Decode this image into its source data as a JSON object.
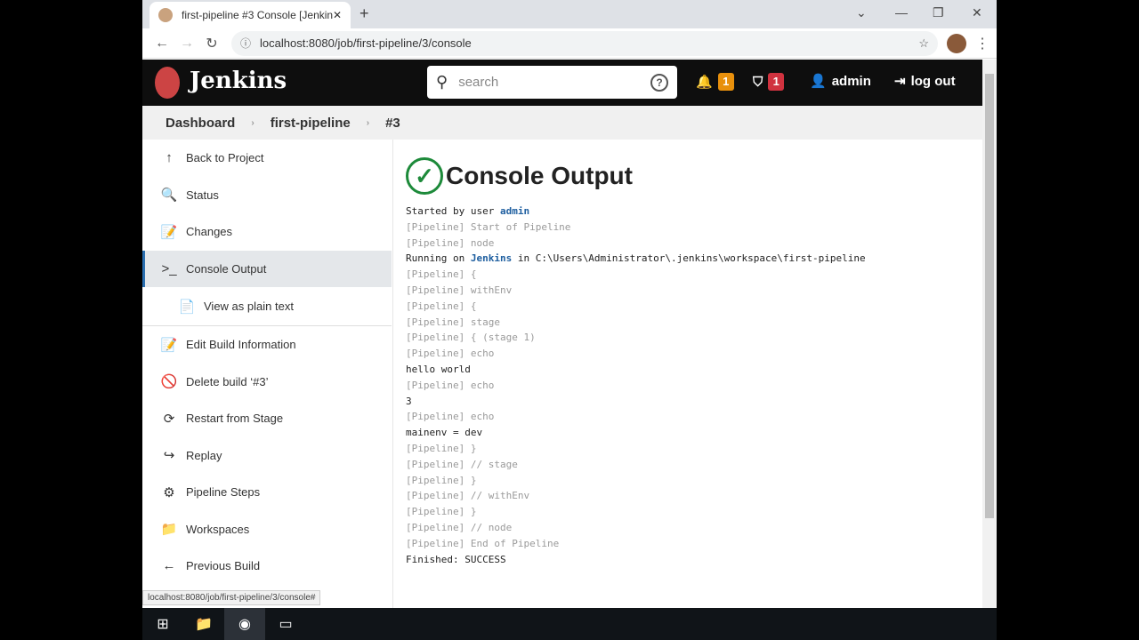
{
  "browser": {
    "tab_title": "first-pipeline #3 Console [Jenkins]",
    "url": "localhost:8080/job/first-pipeline/3/console",
    "status_url": "localhost:8080/job/first-pipeline/3/console#"
  },
  "header": {
    "brand": "Jenkins",
    "search_placeholder": "search",
    "notifications": "1",
    "security": "1",
    "user": "admin",
    "logout": "log out"
  },
  "breadcrumbs": [
    "Dashboard",
    "first-pipeline",
    "#3"
  ],
  "sidebar": [
    {
      "label": "Back to Project",
      "icon": "↑"
    },
    {
      "label": "Status",
      "icon": "🔍"
    },
    {
      "label": "Changes",
      "icon": "📝"
    },
    {
      "label": "Console Output",
      "icon": ">_"
    },
    {
      "label": "View as plain text",
      "icon": "📄"
    },
    {
      "label": "Edit Build Information",
      "icon": "📝"
    },
    {
      "label": "Delete build ‘#3’",
      "icon": "🚫"
    },
    {
      "label": "Restart from Stage",
      "icon": "⟳"
    },
    {
      "label": "Replay",
      "icon": "↪"
    },
    {
      "label": "Pipeline Steps",
      "icon": "⚙"
    },
    {
      "label": "Workspaces",
      "icon": "📁"
    },
    {
      "label": "Previous Build",
      "icon": "←"
    }
  ],
  "main": {
    "title": "Console Output",
    "console": [
      {
        "t": "Started by user ",
        "link": "admin"
      },
      {
        "p": "[Pipeline] Start of Pipeline"
      },
      {
        "p": "[Pipeline] node"
      },
      {
        "t": "Running on ",
        "link": "Jenkins",
        "after": " in C:\\Users\\Administrator\\.jenkins\\workspace\\first-pipeline"
      },
      {
        "p": "[Pipeline] {"
      },
      {
        "p": "[Pipeline] withEnv"
      },
      {
        "p": "[Pipeline] {"
      },
      {
        "p": "[Pipeline] stage"
      },
      {
        "p": "[Pipeline] { (stage 1)"
      },
      {
        "p": "[Pipeline] echo"
      },
      {
        "t": "hello world"
      },
      {
        "p": "[Pipeline] echo"
      },
      {
        "t": "3"
      },
      {
        "p": "[Pipeline] echo"
      },
      {
        "t": "mainenv = dev"
      },
      {
        "p": "[Pipeline] }"
      },
      {
        "p": "[Pipeline] // stage"
      },
      {
        "p": "[Pipeline] }"
      },
      {
        "p": "[Pipeline] // withEnv"
      },
      {
        "p": "[Pipeline] }"
      },
      {
        "p": "[Pipeline] // node"
      },
      {
        "p": "[Pipeline] End of Pipeline"
      },
      {
        "t": "Finished: SUCCESS"
      }
    ]
  }
}
